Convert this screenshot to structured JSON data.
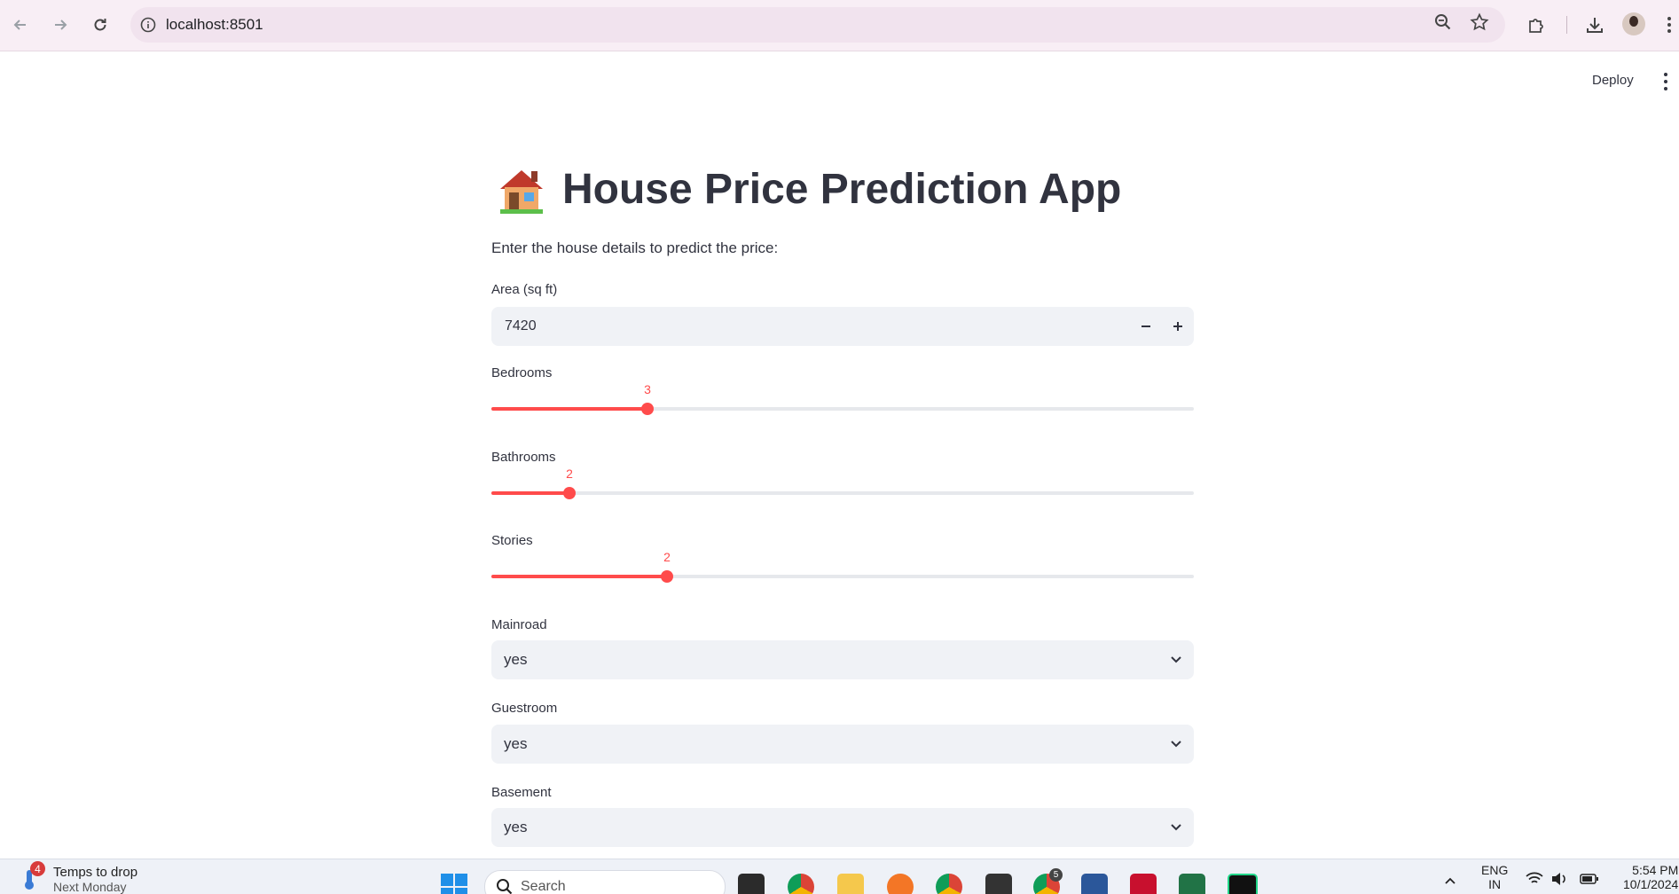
{
  "browser": {
    "url": "localhost:8501"
  },
  "header": {
    "deploy_label": "Deploy"
  },
  "app": {
    "title": "House Price Prediction App",
    "subtitle": "Enter the house details to predict the price:",
    "area": {
      "label": "Area (sq ft)",
      "value": "7420"
    },
    "bedrooms": {
      "label": "Bedrooms",
      "value": "3",
      "fraction": 0.222
    },
    "bathrooms": {
      "label": "Bathrooms",
      "value": "2",
      "fraction": 0.111
    },
    "stories": {
      "label": "Stories",
      "value": "2",
      "fraction": 0.25
    },
    "mainroad": {
      "label": "Mainroad",
      "value": "yes"
    },
    "guestroom": {
      "label": "Guestroom",
      "value": "yes"
    },
    "basement": {
      "label": "Basement",
      "value": "yes"
    },
    "accent_color": "#ff4b4b"
  },
  "taskbar": {
    "weather_badge": "4",
    "weather_title": "Temps to drop",
    "weather_sub": "Next Monday",
    "search_placeholder": "Search",
    "chrome_badge": "5",
    "lang_top": "ENG",
    "lang_bottom": "IN",
    "time": "5:54 PM",
    "date": "10/1/2024"
  }
}
